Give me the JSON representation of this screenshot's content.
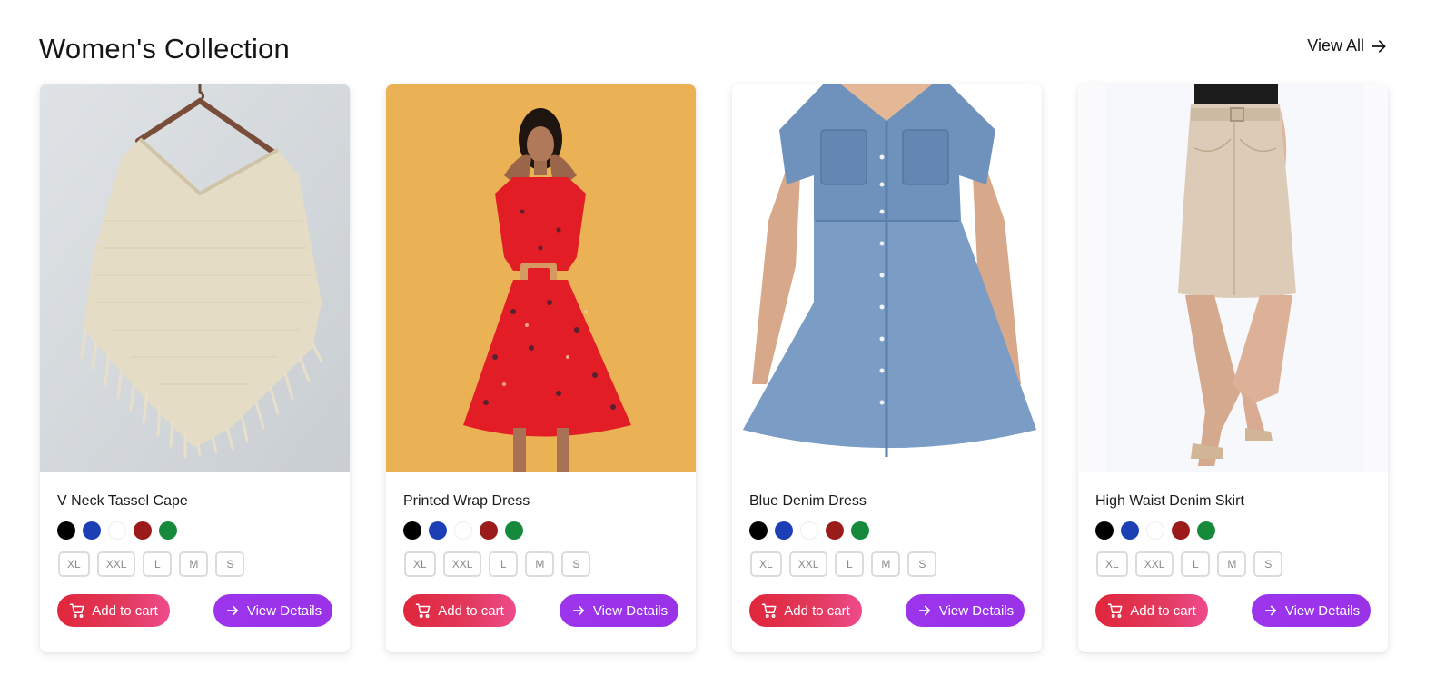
{
  "section": {
    "title": "Women's Collection",
    "view_all_label": "View All"
  },
  "colors": {
    "swatches": [
      "#000000",
      "#1c3fb6",
      "#ffffff",
      "#9b1b1b",
      "#168a3a"
    ],
    "cart_button": "#e02b46",
    "view_button": "#9b34ea"
  },
  "products": [
    {
      "name": "V Neck Tassel Cape",
      "image": "cream knitted poncho cape with fringe on wooden hanger",
      "sizes": [
        "XL",
        "XXL",
        "L",
        "M",
        "S"
      ],
      "add_to_cart_label": "Add to cart",
      "view_details_label": "View Details"
    },
    {
      "name": "Printed Wrap Dress",
      "image": "woman in red floral wrap dress on mustard background",
      "sizes": [
        "XL",
        "XXL",
        "L",
        "M",
        "S"
      ],
      "add_to_cart_label": "Add to cart",
      "view_details_label": "View Details"
    },
    {
      "name": "Blue Denim Dress",
      "image": "light blue denim shirt dress with short sleeves",
      "sizes": [
        "XL",
        "XXL",
        "L",
        "M",
        "S"
      ],
      "add_to_cart_label": "Add to cart",
      "view_details_label": "View Details"
    },
    {
      "name": "High Waist Denim Skirt",
      "image": "beige high waist denim mini skirt with belt and sandals",
      "sizes": [
        "XL",
        "XXL",
        "L",
        "M",
        "S"
      ],
      "add_to_cart_label": "Add to cart",
      "view_details_label": "View Details"
    }
  ]
}
